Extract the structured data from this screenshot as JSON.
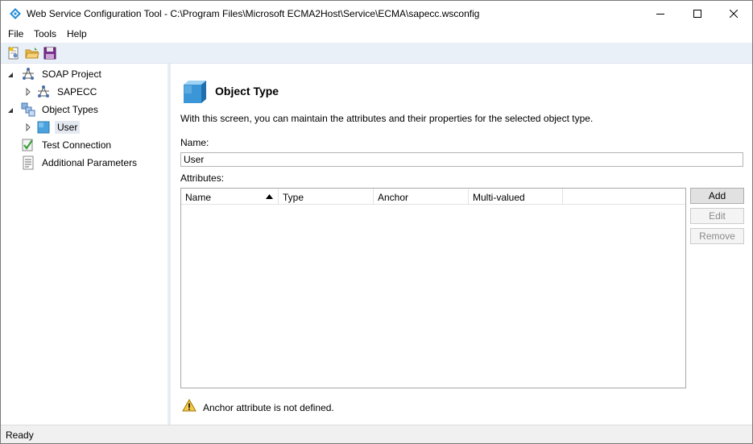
{
  "window": {
    "title": "Web Service Configuration Tool - C:\\Program Files\\Microsoft ECMA2Host\\Service\\ECMA\\sapecc.wsconfig"
  },
  "menu": {
    "items": [
      "File",
      "Tools",
      "Help"
    ]
  },
  "toolbar": {
    "buttons": [
      "new-project-icon",
      "open-folder-icon",
      "save-icon"
    ]
  },
  "tree": {
    "soap_project": "SOAP Project",
    "sapecc": "SAPECC",
    "object_types": "Object Types",
    "user": "User",
    "test_connection": "Test Connection",
    "additional_parameters": "Additional Parameters"
  },
  "panel": {
    "heading": "Object Type",
    "description": "With this screen, you can maintain the attributes and their properties for the selected object type.",
    "name_label": "Name:",
    "name_value": "User",
    "attributes_label": "Attributes:",
    "columns": [
      "Name",
      "Type",
      "Anchor",
      "Multi-valued"
    ],
    "buttons": {
      "add": "Add",
      "edit": "Edit",
      "remove": "Remove"
    },
    "warning": "Anchor attribute is not defined."
  },
  "status": {
    "text": "Ready"
  },
  "colors": {
    "toolbar_bg": "#eaf0f8",
    "accent_cube": "#3a96d6",
    "warning": "#f2c94c"
  }
}
